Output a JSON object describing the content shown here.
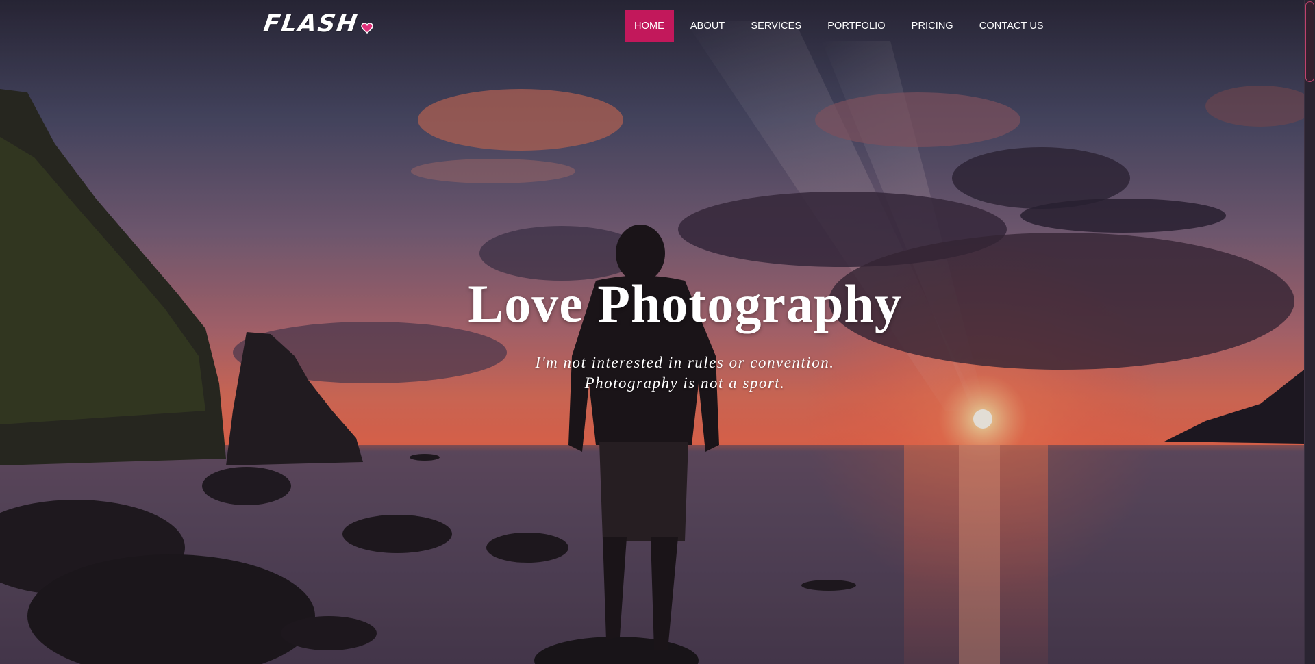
{
  "brand": {
    "name": "FLASH",
    "accent_color": "#c2185b",
    "heart_icon": "heart-icon"
  },
  "nav": {
    "items": [
      {
        "label": "HOME",
        "active": true
      },
      {
        "label": "ABOUT",
        "active": false
      },
      {
        "label": "SERVICES",
        "active": false
      },
      {
        "label": "PORTFOLIO",
        "active": false
      },
      {
        "label": "PRICING",
        "active": false
      },
      {
        "label": "CONTACT US",
        "active": false
      }
    ]
  },
  "hero": {
    "title": "Love Photography",
    "subtitle_line1": "I'm not interested in rules or convention.",
    "subtitle_line2": "Photography is not a sport."
  }
}
